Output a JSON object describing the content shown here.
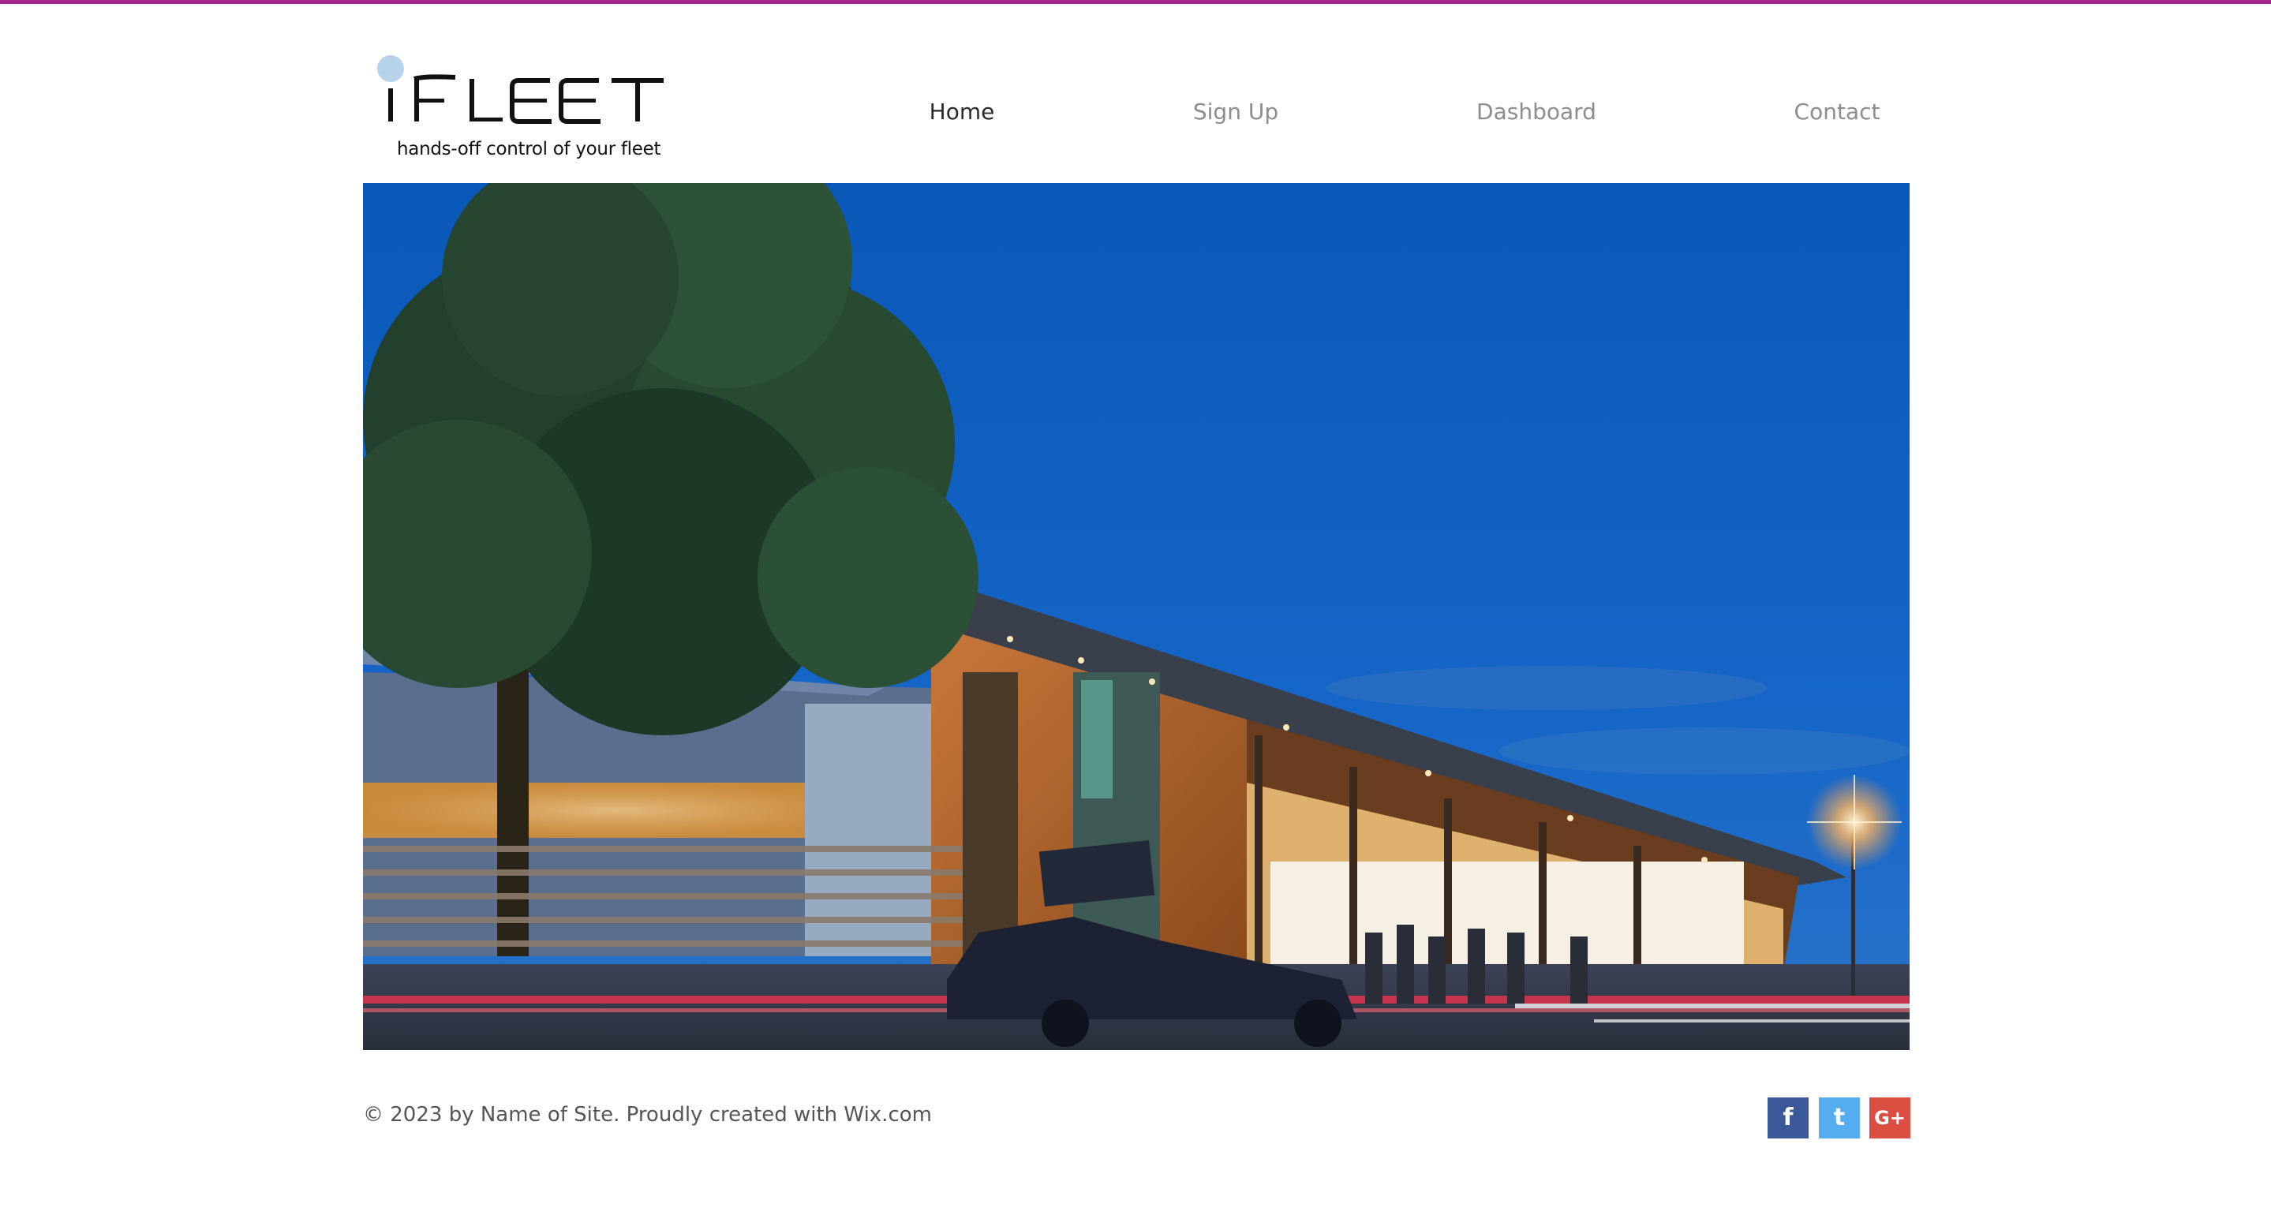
{
  "header": {
    "logo_text": "iFLEET",
    "tagline": "hands-off control of your fleet"
  },
  "nav": {
    "items": [
      {
        "label": "Home",
        "active": true
      },
      {
        "label": "Sign Up",
        "active": false
      },
      {
        "label": "Dashboard",
        "active": false
      },
      {
        "label": "Contact",
        "active": false
      }
    ]
  },
  "footer": {
    "copyright": "© 2023 by Name of Site. Proudly created with Wix.com",
    "social": [
      {
        "icon": "facebook-icon",
        "glyph": "f",
        "color": "#3b5998"
      },
      {
        "icon": "twitter-icon",
        "glyph": "t",
        "color": "#55acee"
      },
      {
        "icon": "google-plus-icon",
        "glyph": "G+",
        "color": "#dc4e41"
      }
    ]
  },
  "colors": {
    "accent_bar": "#a3248f",
    "nav_active": "#2b2b2b",
    "nav_inactive": "#8d8d8d"
  }
}
